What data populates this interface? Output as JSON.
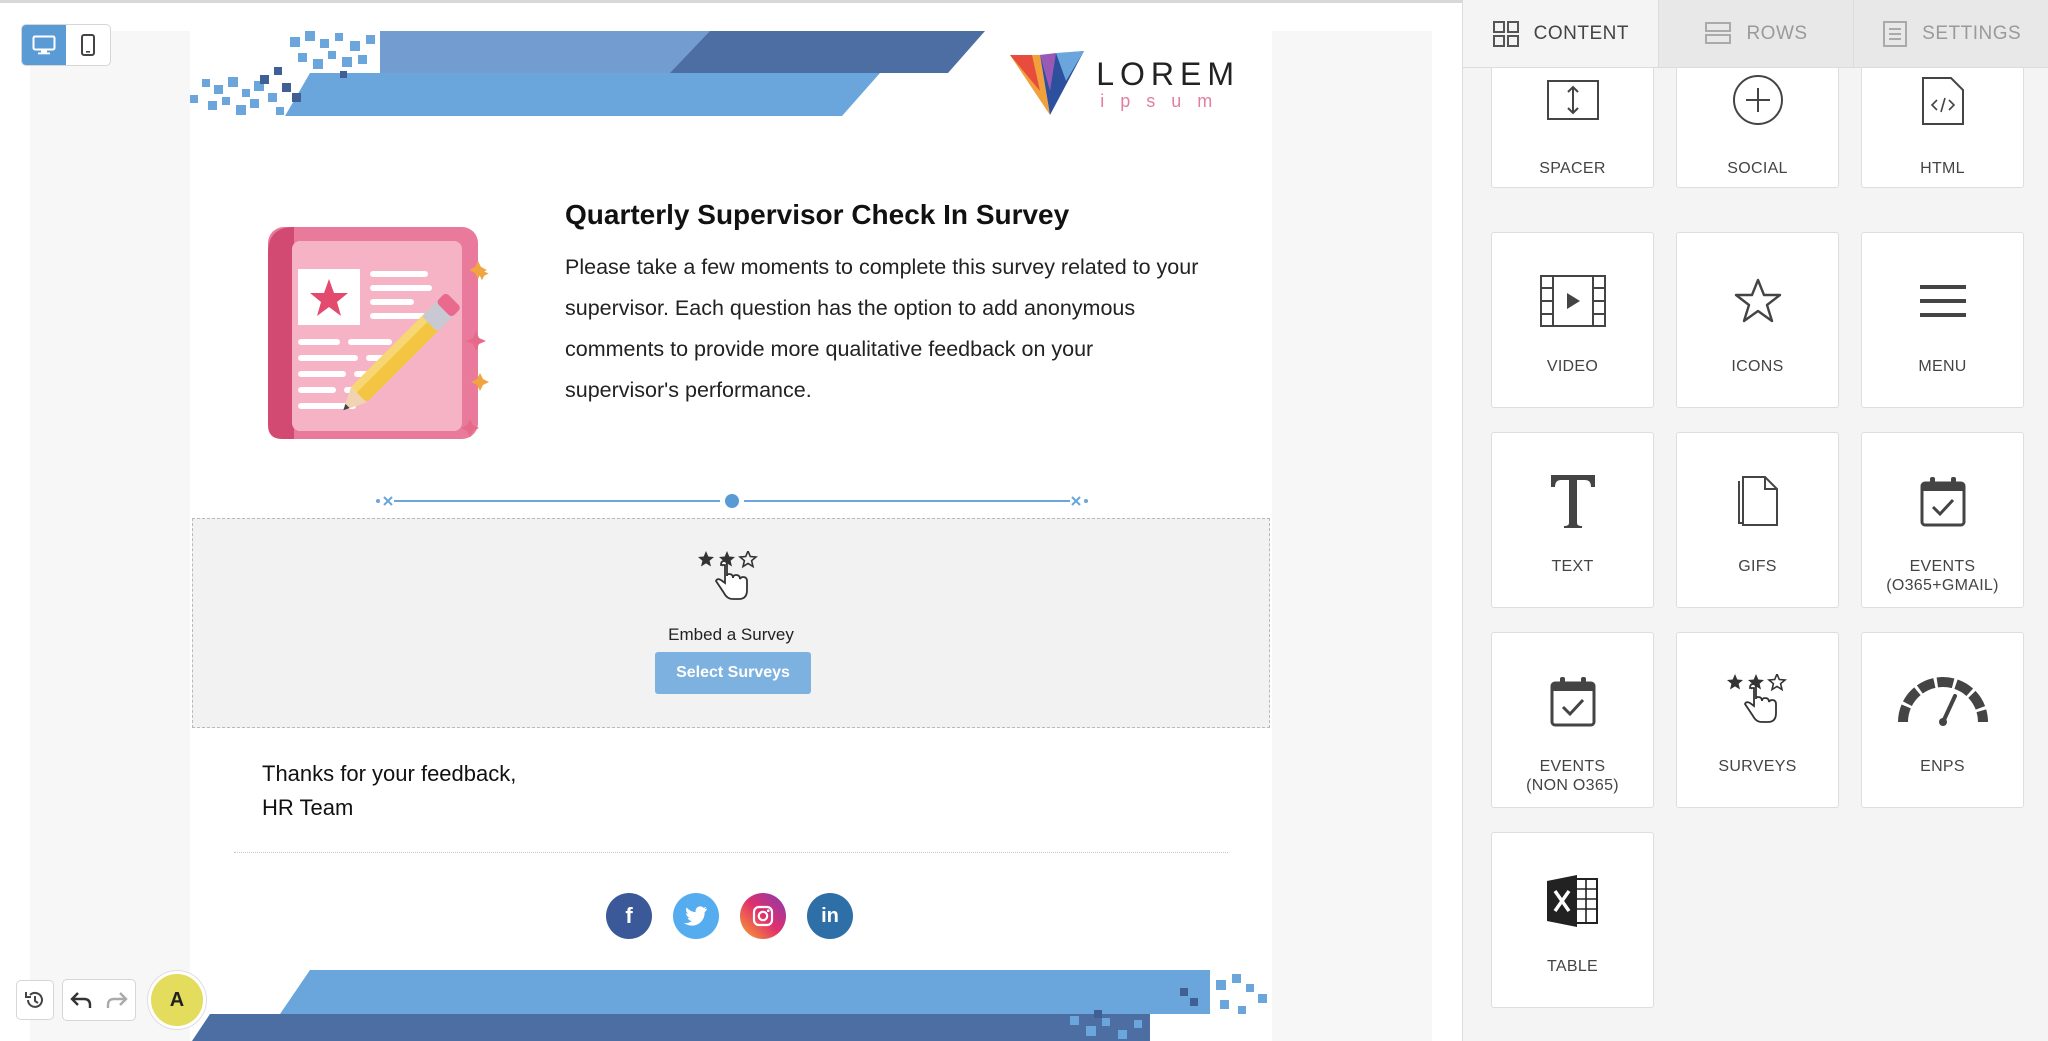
{
  "editor": {
    "view_modes": [
      "desktop",
      "mobile"
    ],
    "active_view": "desktop"
  },
  "email": {
    "logo": {
      "word": "LOREM",
      "sub": "ipsum"
    },
    "title": "Quarterly Supervisor Check In Survey",
    "body": "Please take a few moments to complete this survey related to your supervisor. Each question has the option to add anonymous comments to provide more qualitative feedback on your supervisor's performance.",
    "survey_block": {
      "label": "Embed a Survey",
      "button": "Select Surveys"
    },
    "signoff": {
      "line1": "Thanks for your feedback,",
      "line2": "HR Team"
    },
    "socials": [
      {
        "name": "facebook",
        "glyph": "f",
        "color": "#3b5998"
      },
      {
        "name": "twitter",
        "glyph": "t",
        "color": "#55acee"
      },
      {
        "name": "instagram",
        "glyph": "◎",
        "color": "#c13584"
      },
      {
        "name": "linkedin",
        "glyph": "in",
        "color": "#2f6fa7"
      }
    ]
  },
  "controls": {
    "avatar_initial": "A"
  },
  "panel": {
    "tabs": [
      {
        "label": "CONTENT",
        "icon": "grid-icon",
        "active": true
      },
      {
        "label": "ROWS",
        "icon": "rows-icon",
        "active": false
      },
      {
        "label": "SETTINGS",
        "icon": "settings-icon",
        "active": false
      }
    ],
    "tiles": [
      {
        "label": "SPACER",
        "icon": "spacer-icon"
      },
      {
        "label": "SOCIAL",
        "icon": "social-icon"
      },
      {
        "label": "HTML",
        "icon": "html-icon"
      },
      {
        "label": "VIDEO",
        "icon": "video-icon"
      },
      {
        "label": "ICONS",
        "icon": "star-icon"
      },
      {
        "label": "MENU",
        "icon": "menu-icon"
      },
      {
        "label": "TEXT",
        "icon": "text-icon"
      },
      {
        "label": "GIFS",
        "icon": "gif-icon"
      },
      {
        "label": "EVENTS\n(O365+GMAIL)",
        "icon": "calendar-check-icon"
      },
      {
        "label": "EVENTS\n(NON O365)",
        "icon": "calendar-check-icon"
      },
      {
        "label": "SURVEYS",
        "icon": "survey-icon"
      },
      {
        "label": "ENPS",
        "icon": "gauge-icon"
      },
      {
        "label": "TABLE",
        "icon": "excel-icon"
      }
    ]
  }
}
